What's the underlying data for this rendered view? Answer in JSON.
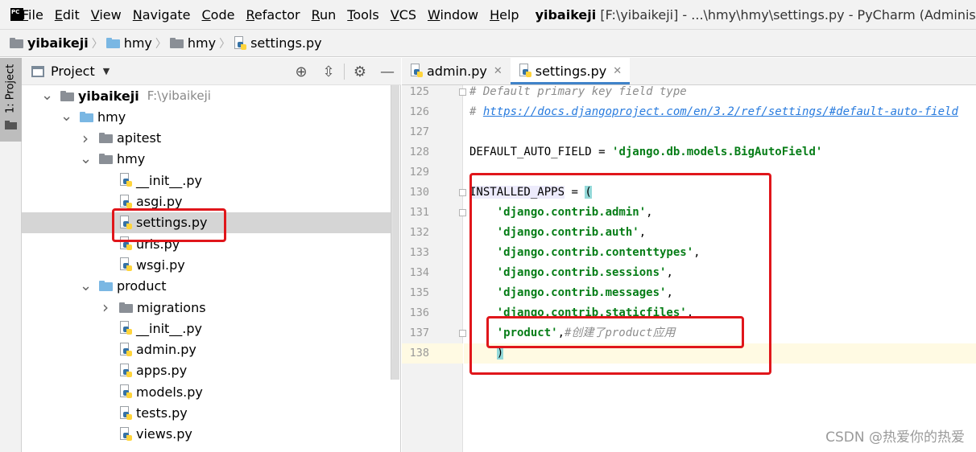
{
  "app": {
    "logo_text": "PC",
    "menu": [
      "File",
      "Edit",
      "View",
      "Navigate",
      "Code",
      "Refactor",
      "Run",
      "Tools",
      "VCS",
      "Window",
      "Help"
    ],
    "window_title": {
      "project": "yibaikeji",
      "path": "[F:\\yibaikeji] - ...\\hmy\\hmy\\settings.py - PyCharm (Administrator)"
    }
  },
  "breadcrumb": [
    "yibaikeji",
    "hmy",
    "hmy",
    "settings.py"
  ],
  "toolstrip": {
    "project_tab": "1: Project"
  },
  "project_panel": {
    "title": "Project",
    "tools": [
      "crosshair-icon",
      "collapse-icon",
      "gear-icon",
      "minimize-icon"
    ],
    "tree": [
      {
        "name": "yibaikeji",
        "hint": "F:\\yibaikeji",
        "level": 0,
        "arrow": "down",
        "icon": "folder-gray",
        "bold": true
      },
      {
        "name": "hmy",
        "level": 1,
        "arrow": "down",
        "icon": "folder-blue"
      },
      {
        "name": "apitest",
        "level": 2,
        "arrow": "right",
        "icon": "folder-gray"
      },
      {
        "name": "hmy",
        "level": 2,
        "arrow": "down",
        "icon": "folder-gray"
      },
      {
        "name": "__init__.py",
        "level": 3,
        "arrow": "none",
        "icon": "py"
      },
      {
        "name": "asgi.py",
        "level": 3,
        "arrow": "none",
        "icon": "py"
      },
      {
        "name": "settings.py",
        "level": 3,
        "arrow": "none",
        "icon": "py",
        "selected": true
      },
      {
        "name": "urls.py",
        "level": 3,
        "arrow": "none",
        "icon": "py"
      },
      {
        "name": "wsgi.py",
        "level": 3,
        "arrow": "none",
        "icon": "py"
      },
      {
        "name": "product",
        "level": 2,
        "arrow": "down",
        "icon": "folder-blue"
      },
      {
        "name": "migrations",
        "level": 3,
        "arrow": "right",
        "icon": "folder-gray"
      },
      {
        "name": "__init__.py",
        "level": 3,
        "arrow": "none",
        "icon": "py"
      },
      {
        "name": "admin.py",
        "level": 3,
        "arrow": "none",
        "icon": "py"
      },
      {
        "name": "apps.py",
        "level": 3,
        "arrow": "none",
        "icon": "py"
      },
      {
        "name": "models.py",
        "level": 3,
        "arrow": "none",
        "icon": "py"
      },
      {
        "name": "tests.py",
        "level": 3,
        "arrow": "none",
        "icon": "py"
      },
      {
        "name": "views.py",
        "level": 3,
        "arrow": "none",
        "icon": "py"
      }
    ]
  },
  "editor": {
    "tabs": [
      {
        "label": "admin.py",
        "active": false
      },
      {
        "label": "settings.py",
        "active": true
      }
    ],
    "lines": [
      {
        "n": "125",
        "parts": [
          {
            "t": "# Default primary key field type",
            "c": "cm"
          }
        ]
      },
      {
        "n": "126",
        "parts": [
          {
            "t": "# ",
            "c": "cm"
          },
          {
            "t": "https://docs.djangoproject.com/en/3.2/ref/settings/#default-auto-field",
            "c": "cm-link"
          }
        ]
      },
      {
        "n": "127",
        "parts": []
      },
      {
        "n": "128",
        "parts": [
          {
            "t": "DEFAULT_AUTO_FIELD = ",
            "c": ""
          },
          {
            "t": "'django.db.models.BigAutoField'",
            "c": "str"
          }
        ]
      },
      {
        "n": "129",
        "parts": []
      },
      {
        "n": "130",
        "parts": [
          {
            "t": "INSTALLED_APPS",
            "c": "ident-hl"
          },
          {
            "t": " = ",
            "c": ""
          },
          {
            "t": "(",
            "c": "brace-hl"
          }
        ]
      },
      {
        "n": "131",
        "parts": [
          {
            "t": "    ",
            "c": ""
          },
          {
            "t": "'django.contrib.admin'",
            "c": "str"
          },
          {
            "t": ",",
            "c": ""
          }
        ]
      },
      {
        "n": "132",
        "parts": [
          {
            "t": "    ",
            "c": ""
          },
          {
            "t": "'django.contrib.auth'",
            "c": "str"
          },
          {
            "t": ",",
            "c": ""
          }
        ]
      },
      {
        "n": "133",
        "parts": [
          {
            "t": "    ",
            "c": ""
          },
          {
            "t": "'django.contrib.contenttypes'",
            "c": "str"
          },
          {
            "t": ",",
            "c": ""
          }
        ]
      },
      {
        "n": "134",
        "parts": [
          {
            "t": "    ",
            "c": ""
          },
          {
            "t": "'django.contrib.sessions'",
            "c": "str"
          },
          {
            "t": ",",
            "c": ""
          }
        ]
      },
      {
        "n": "135",
        "parts": [
          {
            "t": "    ",
            "c": ""
          },
          {
            "t": "'django.contrib.messages'",
            "c": "str"
          },
          {
            "t": ",",
            "c": ""
          }
        ]
      },
      {
        "n": "136",
        "parts": [
          {
            "t": "    ",
            "c": ""
          },
          {
            "t": "'django.contrib.staticfiles'",
            "c": "str"
          },
          {
            "t": ",",
            "c": ""
          }
        ]
      },
      {
        "n": "137",
        "parts": [
          {
            "t": "    ",
            "c": ""
          },
          {
            "t": "'product'",
            "c": "str"
          },
          {
            "t": ",",
            "c": ""
          },
          {
            "t": "#创建了product应用",
            "c": "cn"
          }
        ]
      },
      {
        "n": "138",
        "parts": [
          {
            "t": "    ",
            "c": ""
          },
          {
            "t": ")",
            "c": "brace-hl"
          }
        ]
      }
    ]
  },
  "watermark": "CSDN @热爱你的热爱"
}
